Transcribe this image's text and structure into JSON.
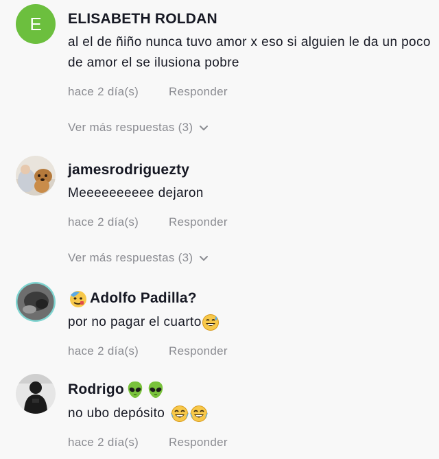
{
  "comments": [
    {
      "avatar_letter": "E",
      "username": "ELISABETH ROLDAN",
      "text": "al el de ñiño nunca tuvo amor x eso si alguien le da un poco de amor el se ilusiona pobre",
      "time": "hace 2 día(s)",
      "reply_label": "Responder",
      "view_more": "Ver más respuestas (3)"
    },
    {
      "username": "jamesrodriguezty",
      "text": "Meeeeeeeeee dejaron",
      "time": "hace 2 día(s)",
      "reply_label": "Responder",
      "view_more": "Ver más respuestas (3)"
    },
    {
      "username": "Adolfo Padilla?",
      "text": "por no pagar el cuarto",
      "time": "hace 2 día(s)",
      "reply_label": "Responder"
    },
    {
      "username": "Rodrigo",
      "text": "no ubo depósito",
      "time": "hace 2 día(s)",
      "reply_label": "Responder"
    }
  ],
  "icons": {
    "chevron": "chevron-down-icon",
    "username_emoji_adolfo": "hot-face-emoji",
    "username_emoji_rodrigo": "alien-emoji",
    "text_emoji_adolfo": "grinning-sweat-emoji",
    "text_emoji_rodrigo": "laughing-tears-emoji"
  },
  "colors": {
    "background": "#f8f8f8",
    "avatar_e": "#6cbf3e",
    "muted_text": "#8a8b91",
    "primary_text": "#161823"
  }
}
